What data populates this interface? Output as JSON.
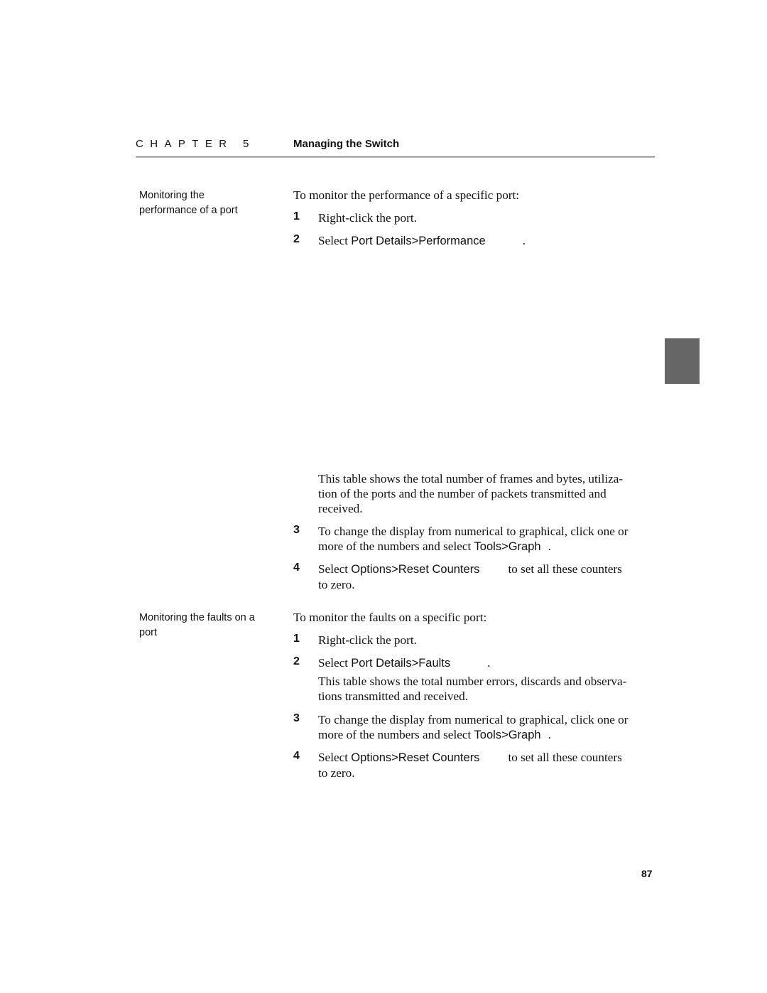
{
  "header": {
    "chapter_label": "CHAPTER 5",
    "chapter_title": "Managing the Switch"
  },
  "sections": [
    {
      "side_heading": "Monitoring the performance of a port",
      "side_heading_lines": [
        "Monitoring the",
        "performance of a port"
      ],
      "intro": "To monitor the performance of a specific port:",
      "steps": [
        {
          "num": "1",
          "text": "Right-click the port."
        },
        {
          "num": "2",
          "prefix": "Select ",
          "ui": "Port Details>Performance",
          "suffix": "."
        }
      ],
      "description": [
        "This table shows the total number of frames and bytes, utiliza-",
        "tion of the ports and the number of packets transmitted and",
        "received."
      ],
      "more_steps": [
        {
          "num": "3",
          "line1": "To change the display from numerical to graphical, click one or",
          "line2_prefix": "more of the numbers and select ",
          "ui": "Tools>Graph",
          "suffix": "."
        },
        {
          "num": "4",
          "prefix": "Select ",
          "ui": "Options>Reset Counters",
          "suffix": "to set all these counters",
          "line2": "to zero."
        }
      ]
    },
    {
      "side_heading": "Monitoring the faults on a port",
      "side_heading_lines": [
        "Monitoring the faults on a",
        "port"
      ],
      "intro": "To monitor the faults on a specific port:",
      "steps": [
        {
          "num": "1",
          "text": "Right-click the port."
        },
        {
          "num": "2",
          "prefix": "Select ",
          "ui": "Port Details>Faults",
          "suffix": "."
        }
      ],
      "description": [
        "This table shows the total number errors, discards and observa-",
        "tions transmitted and received."
      ],
      "more_steps": [
        {
          "num": "3",
          "line1": "To change the display from numerical to graphical, click one or",
          "line2_prefix": "more of the numbers and select ",
          "ui": "Tools>Graph",
          "suffix": "."
        },
        {
          "num": "4",
          "prefix": "Select ",
          "ui": "Options>Reset Counters",
          "suffix": "to set all these counters",
          "line2": "to zero."
        }
      ]
    }
  ],
  "thumb_tab_color": "#666666",
  "page_number": "87"
}
